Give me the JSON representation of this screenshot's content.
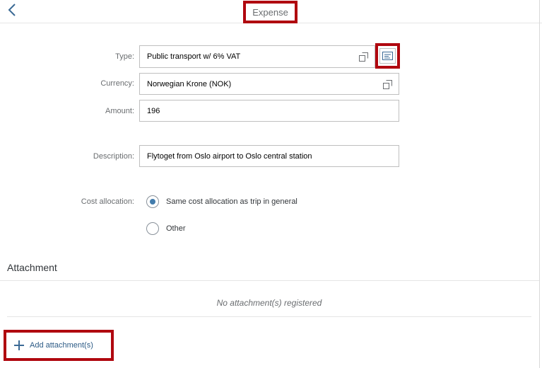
{
  "header": {
    "title": "Expense",
    "back_icon": "chevron-left-icon"
  },
  "form": {
    "type": {
      "label": "Type:",
      "value": "Public transport w/ 6% VAT"
    },
    "currency": {
      "label": "Currency:",
      "value": "Norwegian Krone (NOK)"
    },
    "amount": {
      "label": "Amount:",
      "value": "196"
    },
    "description": {
      "label": "Description:",
      "value": "Flytoget from Oslo airport to Oslo central station"
    },
    "cost_allocation": {
      "label": "Cost allocation:",
      "options": [
        {
          "label": "Same cost allocation as trip in general",
          "selected": true
        },
        {
          "label": "Other",
          "selected": false
        }
      ]
    }
  },
  "attachment": {
    "title": "Attachment",
    "empty_text": "No attachment(s) registered",
    "add_label": "Add attachment(s)"
  },
  "colors": {
    "highlight": "#b0070f",
    "accent": "#427cac"
  }
}
